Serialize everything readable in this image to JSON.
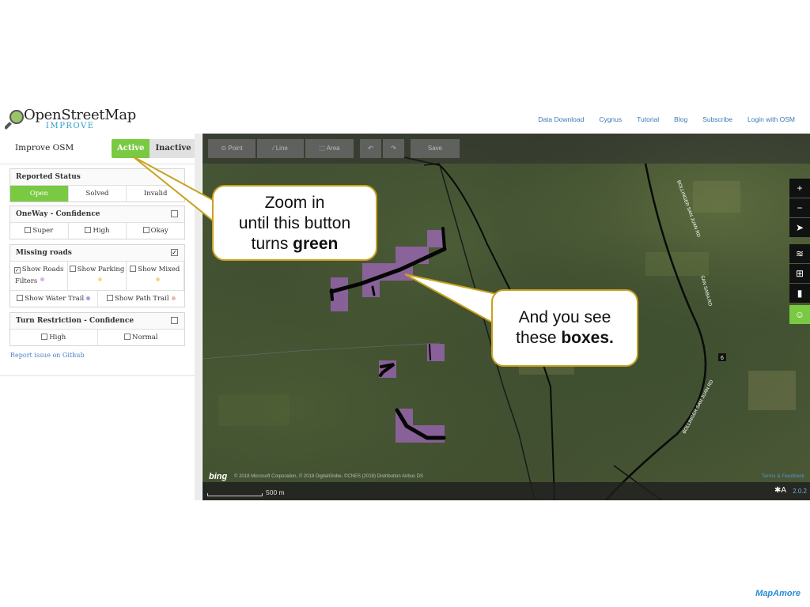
{
  "header": {
    "logo_title": "OpenStreetMap",
    "logo_sub": "IMPROVE",
    "nav": [
      "Data Download",
      "Cygnus",
      "Tutorial",
      "Blog",
      "Subscribe",
      "Login with OSM"
    ]
  },
  "sidebar": {
    "title": "Improve OSM",
    "toggle_active": "Active",
    "toggle_inactive": "Inactive",
    "reported_status": {
      "title": "Reported Status",
      "options": [
        "Open",
        "Solved",
        "Invalid"
      ],
      "selected": "Open"
    },
    "oneway": {
      "title": "OneWay - Confidence",
      "options": [
        "Super",
        "High",
        "Okay"
      ]
    },
    "missing_roads": {
      "title": "Missing roads",
      "checked": true,
      "options": [
        "Show Roads",
        "Show Parking",
        "Show Mixed"
      ],
      "filters_label": "Filters",
      "options2": [
        "Show Water Trail",
        "Show Path Trail"
      ]
    },
    "turn_restriction": {
      "title": "Turn Restriction - Confidence",
      "options": [
        "High",
        "Normal"
      ]
    },
    "github_link": "Report issue on Github"
  },
  "map": {
    "toolbar": {
      "point": "Point",
      "line": "Line",
      "area": "Area",
      "save": "Save"
    },
    "attribution": "© 2018 Microsoft Corporation, © 2018 DigitalGlobe, ©CNES (2018) Distribution Airbus DS",
    "bing": "bing",
    "terms": "Terms & Feedback",
    "scale": "500 m",
    "version": "2.0.2",
    "road_label_1": "BOLLINGER SAN JUAN RD",
    "road_label_2": "SAN SABA RD",
    "road_label_3": "BOLLINGER SAN JUAN RD",
    "route_badge": "6"
  },
  "callouts": {
    "zoom_line1": "Zoom in",
    "zoom_line2": "until this button",
    "zoom_line3a": "turns ",
    "zoom_line3b": "green",
    "boxes_line1": "And you see",
    "boxes_line2a": "these ",
    "boxes_line2b": "boxes."
  },
  "brand": "MapAmore",
  "colors": {
    "active_green": "#7ac943",
    "callout_border": "#c8a21e",
    "box_purple": "#b36ad8",
    "link_blue": "#3a78b8"
  }
}
